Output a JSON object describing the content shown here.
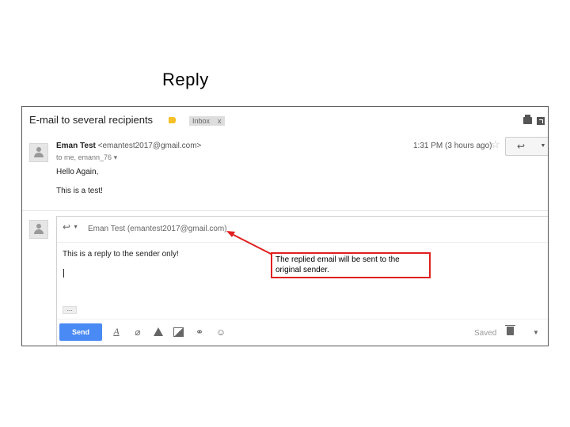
{
  "slide": {
    "title": "Reply"
  },
  "email": {
    "subject": "E-mail to several recipients",
    "inbox_label": "Inbox",
    "inbox_close": "x",
    "label_color": "#f6c026",
    "sender_name": "Eman Test",
    "sender_email": "<emantest2017@gmail.com>",
    "to_line": "to me, emann_76",
    "to_caret": "▾",
    "time": "1:31 PM (3 hours ago)",
    "star": "☆",
    "reply_icon": "↩",
    "more_caret": "▼",
    "greeting": "Hello Again,",
    "body": "This is a test!"
  },
  "reply": {
    "reply_icon": "↩",
    "reply_caret": "▼",
    "recipient": "Eman Test (emantest2017@gmail.com)",
    "text": "This is a reply to the sender only!",
    "expand": "...",
    "send_label": "Send",
    "send_color": "#4a8af4",
    "saved_label": "Saved",
    "more_caret": "▼",
    "toolbar_icons": [
      "text-format-icon",
      "attach-icon",
      "drive-icon",
      "photo-icon",
      "link-icon",
      "emoji-icon"
    ]
  },
  "annotation": {
    "text": "The replied email will be sent to the original sender.",
    "border_color": "#e02020"
  }
}
